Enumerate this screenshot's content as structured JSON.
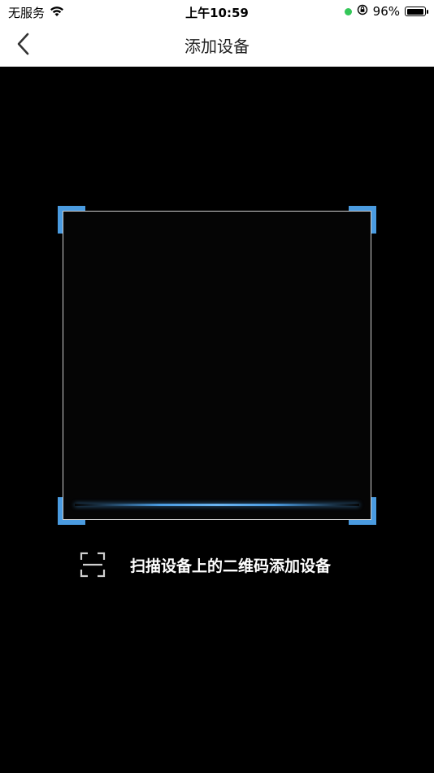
{
  "status_bar": {
    "carrier": "无服务",
    "time": "上午10:59",
    "battery_percent_label": "96%",
    "battery_level": 0.96,
    "indicator_color": "#34c759"
  },
  "nav": {
    "title": "添加设备"
  },
  "scanner": {
    "accent_color": "#4a9be0",
    "hint": "扫描设备上的二维码添加设备"
  }
}
